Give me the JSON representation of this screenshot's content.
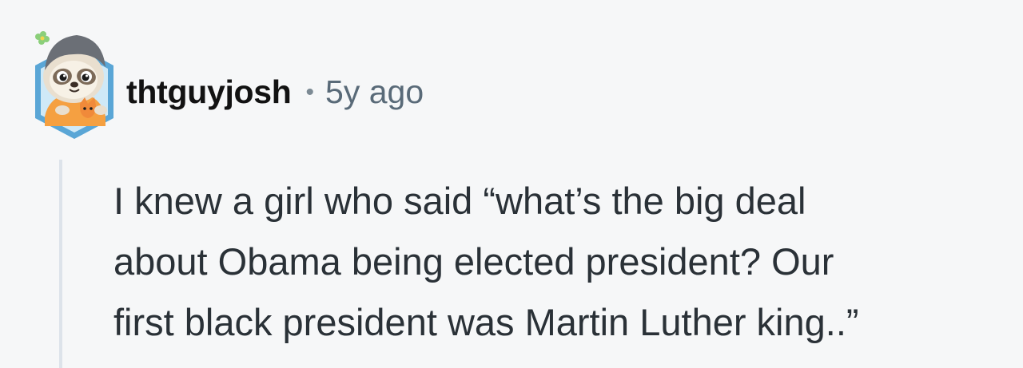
{
  "comment": {
    "username": "thtguyjosh",
    "separator": "•",
    "timestamp": "5y ago",
    "body_lines": [
      "I knew a girl who said “what’s the big deal",
      "about Obama being elected president? Our",
      "first black president was Martin Luther king..”"
    ],
    "avatar": {
      "icon": "sloth-avatar-icon",
      "frame_color": "#5aa6d6",
      "accent_color": "#f5a041"
    }
  }
}
